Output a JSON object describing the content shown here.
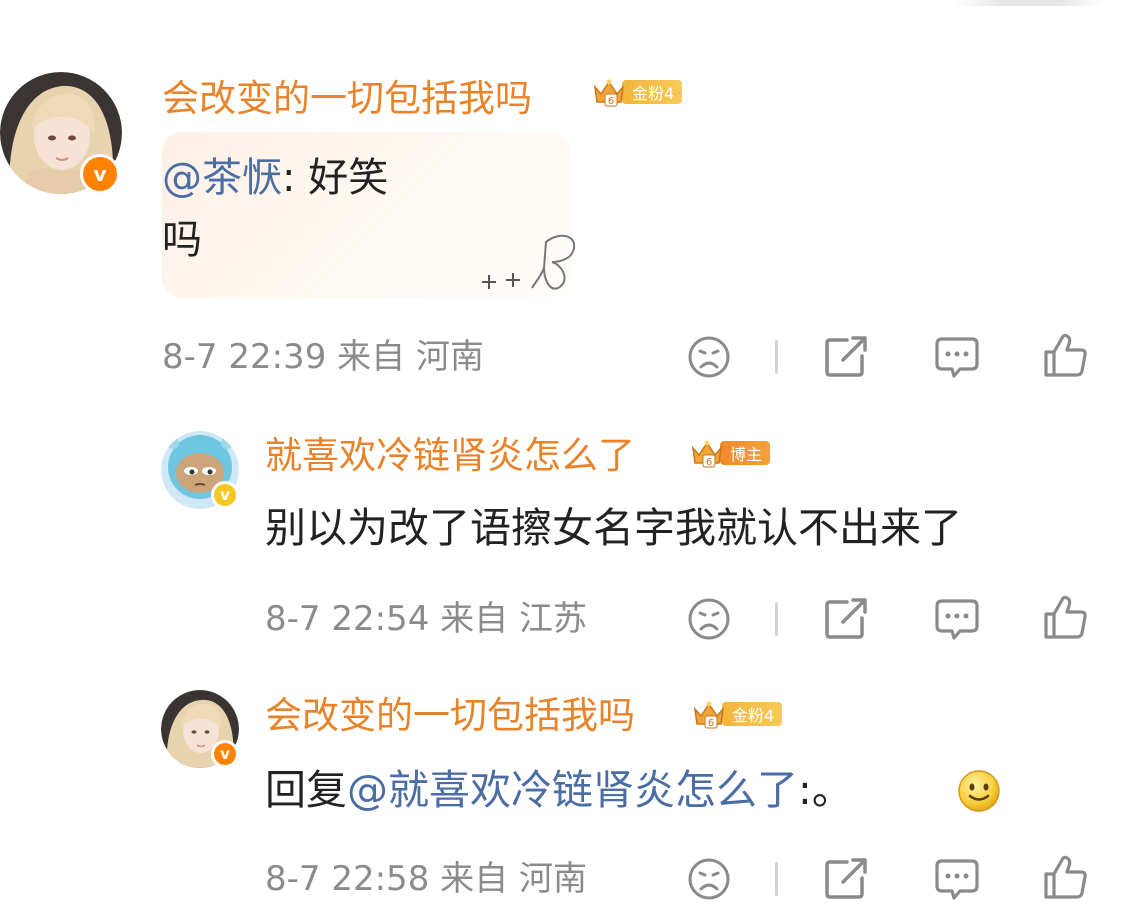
{
  "comments": [
    {
      "username": "会改变的一切包括我吗",
      "badge": {
        "level": "6",
        "label": "金粉4"
      },
      "mention": "@茶恹",
      "text_line1": ": 好笑",
      "text_line2": "吗",
      "time": "8-7 22:39",
      "location": "来自 河南"
    },
    {
      "username": "就喜欢冷链肾炎怎么了",
      "badge": {
        "level": "6",
        "label": "博主"
      },
      "text": "别以为改了语擦女名字我就认不出来了",
      "time": "8-7 22:54",
      "location": "来自 江苏"
    },
    {
      "username": "会改变的一切包括我吗",
      "badge": {
        "level": "6",
        "label": "金粉4"
      },
      "reply_prefix": "回复",
      "mention": "@就喜欢冷链肾炎怎么了",
      "text_suffix": ":。",
      "emoji": "smile-emoji",
      "time": "8-7 22:58",
      "location": "来自 河南"
    }
  ],
  "verified_mark": "v",
  "colors": {
    "username": "#e8832a",
    "mention": "#4b6da3",
    "meta": "#8b8b8b",
    "icon": "#8a8a8a",
    "badge_gold": "#f4b53b",
    "badge_host": "#ef8a2a"
  },
  "icons": [
    "sad-face-icon",
    "share-icon",
    "comment-icon",
    "like-icon"
  ]
}
